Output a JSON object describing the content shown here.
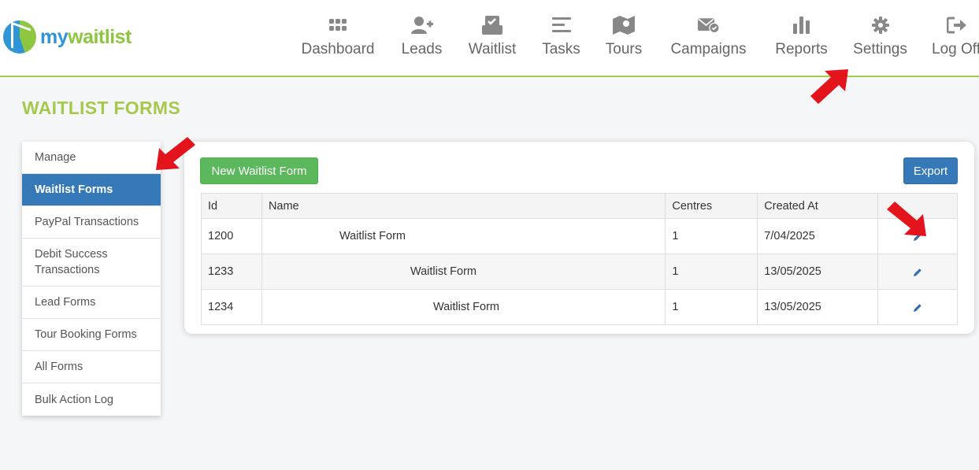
{
  "brand": {
    "prefix": "my",
    "suffix": "waitlist"
  },
  "nav": [
    {
      "label": "Dashboard",
      "icon": "grid-icon"
    },
    {
      "label": "Leads",
      "icon": "add-user-icon"
    },
    {
      "label": "Waitlist",
      "icon": "inbox-check-icon"
    },
    {
      "label": "Tasks",
      "icon": "list-icon"
    },
    {
      "label": "Tours",
      "icon": "map-icon"
    },
    {
      "label": "Campaigns",
      "icon": "mail-check-icon"
    },
    {
      "label": "Reports",
      "icon": "bar-chart-icon"
    },
    {
      "label": "Settings",
      "icon": "gear-icon"
    },
    {
      "label": "Log Off",
      "icon": "sign-out-icon"
    }
  ],
  "page_title": "WAITLIST FORMS",
  "sidebar": {
    "items": [
      {
        "label": "Manage"
      },
      {
        "label": "Waitlist Forms",
        "active": true
      },
      {
        "label": "PayPal Transactions"
      },
      {
        "label": "Debit Success Transactions"
      },
      {
        "label": "Lead Forms"
      },
      {
        "label": "Tour Booking Forms"
      },
      {
        "label": "All Forms"
      },
      {
        "label": "Bulk Action Log"
      }
    ]
  },
  "toolbar": {
    "new_label": "New Waitlist Form",
    "export_label": "Export"
  },
  "table": {
    "headers": [
      "Id",
      "Name",
      "Centres",
      "Created At",
      ""
    ],
    "rows": [
      {
        "id": "1200",
        "name": "Waitlist Form",
        "centres": "1",
        "created": "7/04/2025"
      },
      {
        "id": "1233",
        "name": "Waitlist Form",
        "centres": "1",
        "created": "13/05/2025"
      },
      {
        "id": "1234",
        "name": "Waitlist Form",
        "centres": "1",
        "created": "13/05/2025"
      }
    ]
  },
  "colors": {
    "accent_green": "#a6c94b",
    "primary_blue": "#3579b8",
    "success_green": "#5cb85c",
    "annotation_red": "#e3141b"
  }
}
